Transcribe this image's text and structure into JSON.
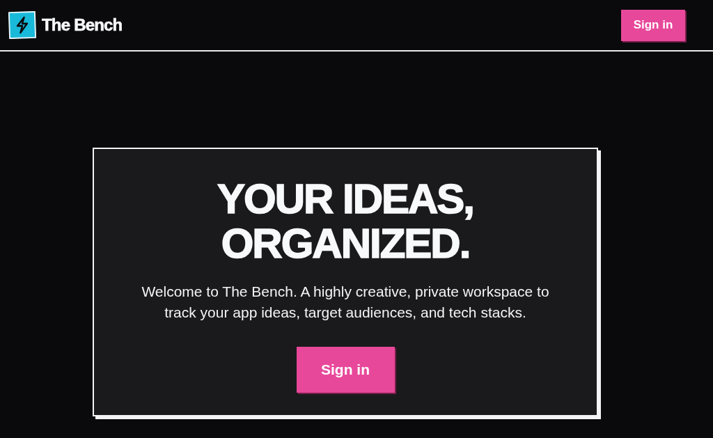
{
  "navbar": {
    "brand": "The Bench",
    "sign_in_button": "Sign in"
  },
  "hero": {
    "heading_lines": [
      "YOUR IDEAS,",
      "ORGANIZED."
    ],
    "description": "Welcome to The Bench. A highly creative, private workspace to track your app ideas, target audiences, and tech stacks.",
    "sign_in_button": "Sign in"
  }
}
